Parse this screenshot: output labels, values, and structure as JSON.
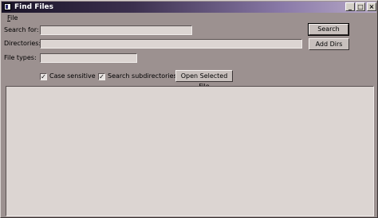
{
  "window": {
    "title": "Find Files"
  },
  "titlebar": {
    "minimize_glyph": "_",
    "maximize_glyph": "□",
    "close_glyph": "×"
  },
  "menu": {
    "file_label_mnemonic": "F",
    "file_label_rest": "ile"
  },
  "form": {
    "search_label": "Search for:",
    "search_value": "",
    "directories_label": "Directories:",
    "directories_value": "",
    "filetypes_label": "File types:",
    "filetypes_value": ""
  },
  "buttons": {
    "search": "Search",
    "add_dirs": "Add Dirs",
    "open_selected": "Open Selected File"
  },
  "options": {
    "case_sensitive_label": "Case sensitive",
    "case_sensitive_checked": true,
    "subdirs_label": "Search subdirectories",
    "subdirs_checked": true,
    "check_glyph": "✓"
  },
  "colors": {
    "window_bg": "#9c9190",
    "field_bg": "#dcd5d2",
    "title_dark": "#1a1428",
    "title_light": "#b8aac8"
  }
}
